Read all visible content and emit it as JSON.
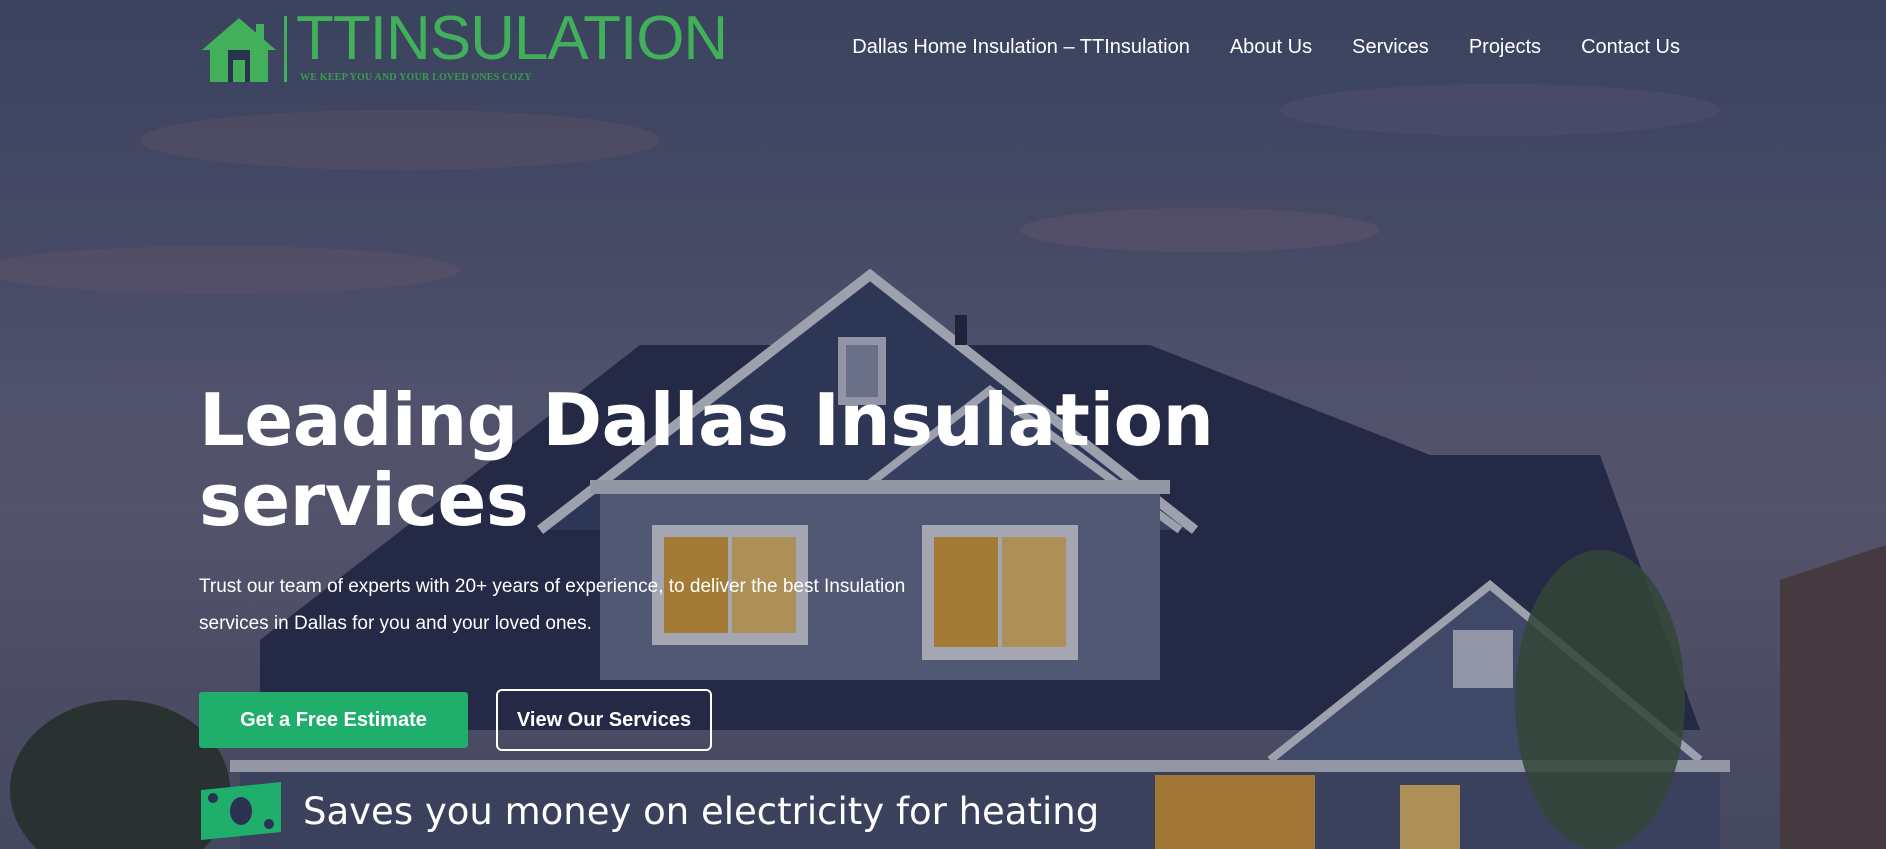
{
  "header": {
    "logo_text": "TTINSULATION",
    "logo_tagline": "WE KEEP YOU AND YOUR LOVED ONES COZY",
    "nav": [
      {
        "label": "Dallas Home Insulation – TTInsulation"
      },
      {
        "label": "About Us"
      },
      {
        "label": "Services"
      },
      {
        "label": "Projects"
      },
      {
        "label": "Contact Us"
      }
    ]
  },
  "hero": {
    "title": "Leading Dallas Insulation services",
    "subtitle": "Trust our team of experts with 20+ years of experience, to deliver the best Insulation services in Dallas for you and your loved ones.",
    "primary_button": "Get a Free Estimate",
    "secondary_button": "View Our Services",
    "feature_text": "Saves you money on electricity for heating",
    "feature_icon": "money-bill-icon"
  },
  "colors": {
    "brand_green": "#42b05a",
    "button_green": "#1fae6c",
    "text": "#ffffff"
  }
}
